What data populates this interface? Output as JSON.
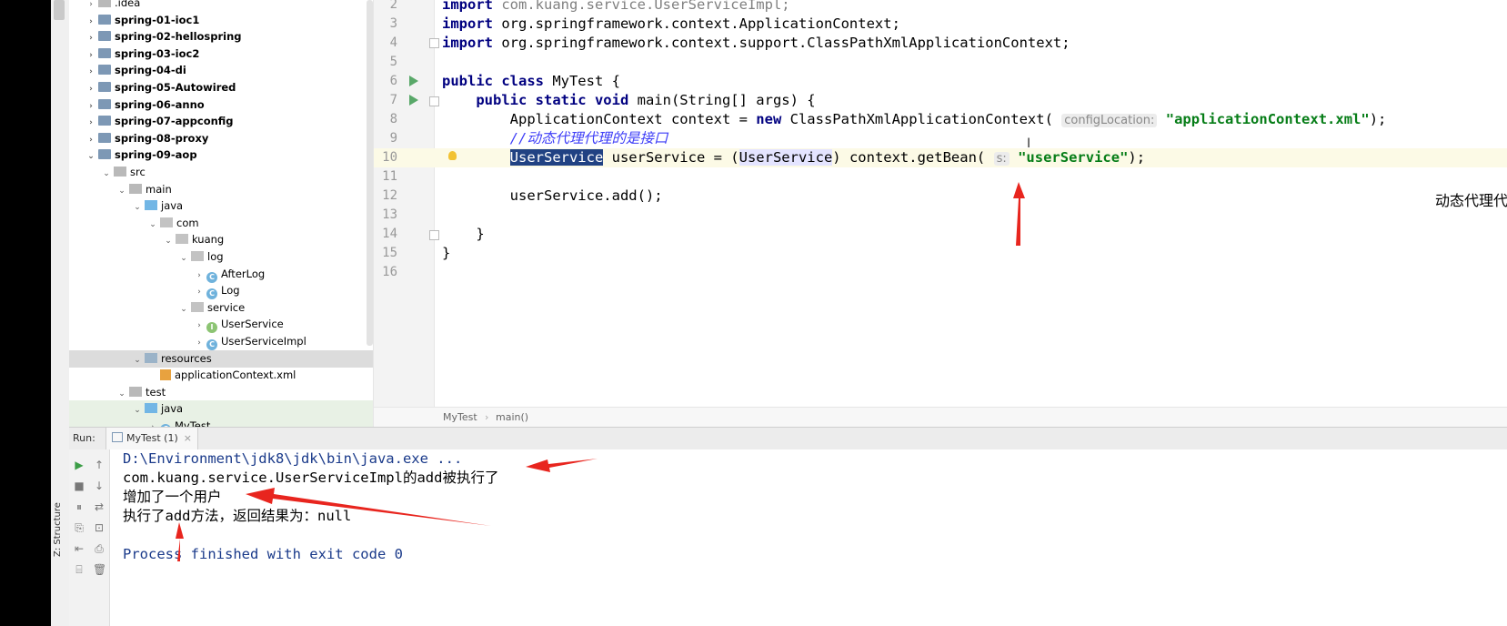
{
  "sidebar": {
    "structure_tab": "Z: Structure",
    "tree": [
      {
        "label": ".idea",
        "indent": 0,
        "icon": "folder",
        "twisty": ">",
        "bold": false
      },
      {
        "label": "spring-01-ioc1",
        "indent": 0,
        "icon": "module",
        "twisty": ">",
        "bold": true
      },
      {
        "label": "spring-02-hellospring",
        "indent": 0,
        "icon": "module",
        "twisty": ">",
        "bold": true
      },
      {
        "label": "spring-03-ioc2",
        "indent": 0,
        "icon": "module",
        "twisty": ">",
        "bold": true
      },
      {
        "label": "spring-04-di",
        "indent": 0,
        "icon": "module",
        "twisty": ">",
        "bold": true
      },
      {
        "label": "spring-05-Autowired",
        "indent": 0,
        "icon": "module",
        "twisty": ">",
        "bold": true
      },
      {
        "label": "spring-06-anno",
        "indent": 0,
        "icon": "module",
        "twisty": ">",
        "bold": true
      },
      {
        "label": "spring-07-appconfig",
        "indent": 0,
        "icon": "module",
        "twisty": ">",
        "bold": true
      },
      {
        "label": "spring-08-proxy",
        "indent": 0,
        "icon": "module",
        "twisty": ">",
        "bold": true
      },
      {
        "label": "spring-09-aop",
        "indent": 0,
        "icon": "module",
        "twisty": "v",
        "bold": true
      },
      {
        "label": "src",
        "indent": 1,
        "icon": "folder",
        "twisty": "v",
        "bold": false
      },
      {
        "label": "main",
        "indent": 2,
        "icon": "folder",
        "twisty": "v",
        "bold": false
      },
      {
        "label": "java",
        "indent": 3,
        "icon": "src-folder",
        "twisty": "v",
        "bold": false
      },
      {
        "label": "com",
        "indent": 4,
        "icon": "package",
        "twisty": "v",
        "bold": false
      },
      {
        "label": "kuang",
        "indent": 5,
        "icon": "package",
        "twisty": "v",
        "bold": false
      },
      {
        "label": "log",
        "indent": 6,
        "icon": "package",
        "twisty": "v",
        "bold": false
      },
      {
        "label": "AfterLog",
        "indent": 7,
        "icon": "class",
        "twisty": ">",
        "bold": false
      },
      {
        "label": "Log",
        "indent": 7,
        "icon": "class",
        "twisty": ">",
        "bold": false
      },
      {
        "label": "service",
        "indent": 6,
        "icon": "package",
        "twisty": "v",
        "bold": false
      },
      {
        "label": "UserService",
        "indent": 7,
        "icon": "interface",
        "twisty": ">",
        "bold": false
      },
      {
        "label": "UserServiceImpl",
        "indent": 7,
        "icon": "class",
        "twisty": ">",
        "bold": false
      },
      {
        "label": "resources",
        "indent": 3,
        "icon": "res-folder",
        "twisty": "v",
        "bold": false,
        "selected": true
      },
      {
        "label": "applicationContext.xml",
        "indent": 4,
        "icon": "xml",
        "twisty": "",
        "bold": false
      },
      {
        "label": "test",
        "indent": 2,
        "icon": "folder",
        "twisty": "v",
        "bold": false
      },
      {
        "label": "java",
        "indent": 3,
        "icon": "src-folder",
        "twisty": "v",
        "bold": false,
        "green": true
      },
      {
        "label": "MyTest",
        "indent": 4,
        "icon": "class",
        "twisty": ">",
        "bold": false,
        "green": true
      }
    ]
  },
  "editor": {
    "lines": [
      {
        "n": "2",
        "html": "<span class=\"kw\">import</span> <span class=\"gray\">com.kuang.service.UserServiceImpl;</span>"
      },
      {
        "n": "3",
        "html": "<span class=\"kw\">import</span> org.springframework.context.ApplicationContext;"
      },
      {
        "n": "4",
        "html": "<span class=\"kw\">import</span> org.springframework.context.support.ClassPathXmlApplicationContext;"
      },
      {
        "n": "5",
        "html": ""
      },
      {
        "n": "6",
        "html": "<span class=\"kw\">public class</span> MyTest {"
      },
      {
        "n": "7",
        "html": "    <span class=\"kw\">public static void</span> main(String[] args) {"
      },
      {
        "n": "8",
        "html": "        ApplicationContext context = <span class=\"kw\">new</span> ClassPathXmlApplicationContext( <span class=\"hint\">configLocation:</span> <span class=\"str\">\"applicationContext.xml\"</span>);"
      },
      {
        "n": "9",
        "html": "        <span class=\"cmt\">//动态代理代理的是接口</span>"
      },
      {
        "n": "10",
        "html": "        <span class=\"sel\">UserService</span> userService = (<span class=\"usage\">UserService</span>) context.getBean( <span class=\"hint\">s:</span> <span class=\"str\">\"userService\"</span>);",
        "current": true
      },
      {
        "n": "11",
        "html": ""
      },
      {
        "n": "12",
        "html": "        userService.add();"
      },
      {
        "n": "13",
        "html": ""
      },
      {
        "n": "14",
        "html": "    }"
      },
      {
        "n": "15",
        "html": "}"
      },
      {
        "n": "16",
        "html": ""
      }
    ],
    "breadcrumb": [
      "MyTest",
      "main()"
    ],
    "annotation": "动态代理代理的是接口",
    "cursor": "I"
  },
  "run": {
    "label": "Run:",
    "tab": "MyTest (1)",
    "tab_close": "×",
    "console": [
      {
        "text": "D:\\Environment\\jdk8\\jdk\\bin\\java.exe ...",
        "kind": "path"
      },
      {
        "text": "com.kuang.service.UserServiceImpl的add被执行了",
        "kind": "out"
      },
      {
        "text": "增加了一个用户",
        "kind": "out"
      },
      {
        "text": "执行了add方法，返回结果为：null",
        "kind": "out"
      },
      {
        "text": "",
        "kind": "out"
      },
      {
        "text": "Process finished with exit code 0",
        "kind": "exit"
      }
    ],
    "tools_left": [
      "▶",
      "■",
      "⏸",
      "⎘",
      "⇤",
      "⌸"
    ],
    "tools_right": [
      "↑",
      "↓",
      "⇄",
      "⊡",
      "⎙",
      "🗑"
    ]
  },
  "colors": {
    "annotation_arrow": "#e8251e",
    "keyword": "#000080",
    "string": "#067d17",
    "comment": "#3d3df7",
    "selection": "#214283"
  }
}
